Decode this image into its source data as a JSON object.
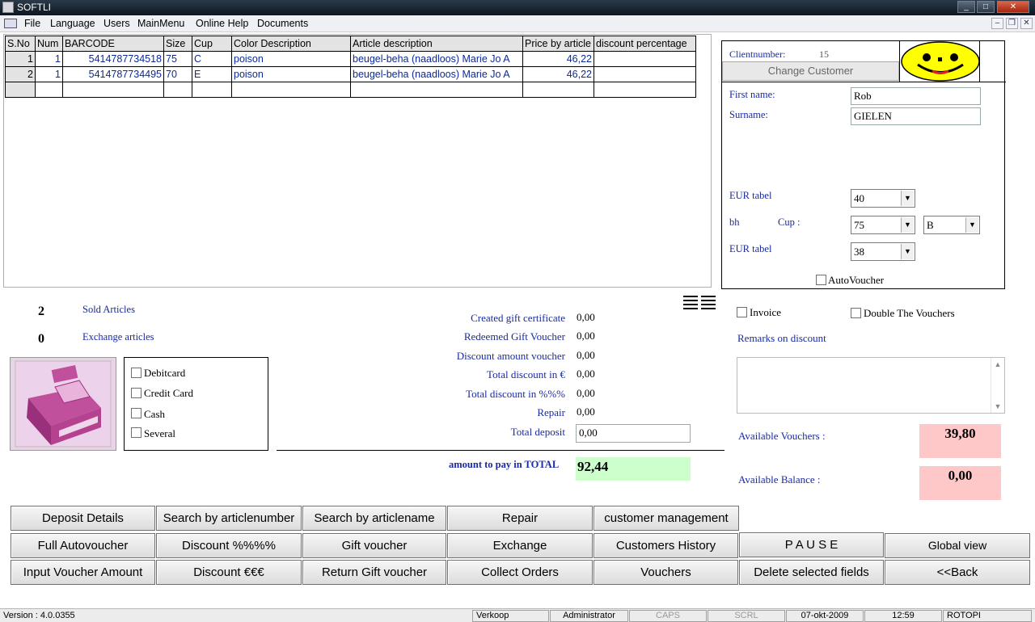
{
  "window": {
    "title": "SOFTLI"
  },
  "menu": [
    "File",
    "Language",
    "Users",
    "MainMenu",
    "Online Help",
    "Documents"
  ],
  "grid": {
    "columns": [
      "S.No",
      "Num",
      "BARCODE",
      "Size",
      "Cup",
      "Color Description",
      "Article description",
      "Price by article",
      "discount percentage"
    ],
    "rows": [
      {
        "sno": "1",
        "num": "1",
        "barcode": "5414787734518",
        "size": "75",
        "cup": "C",
        "color": "poison",
        "article": "beugel-beha (naadloos) Marie Jo A",
        "price": "46,22",
        "discount": ""
      },
      {
        "sno": "2",
        "num": "1",
        "barcode": "5414787734495",
        "size": "70",
        "cup": "E",
        "color": "poison",
        "article": "beugel-beha (naadloos) Marie Jo A",
        "price": "46,22",
        "discount": ""
      }
    ]
  },
  "client": {
    "clientnumber_label": "Clientnumber:",
    "clientnumber": "15",
    "change_customer": "Change Customer",
    "first_name_label": "First name:",
    "first_name": "Rob",
    "surname_label": "Surname:",
    "surname": "GIELEN",
    "eur_tabel_label_1": "EUR tabel",
    "eur_tabel_1": "40",
    "bh_label": "bh",
    "cup_label": "Cup :",
    "bh_size": "75",
    "cup_value": "B",
    "eur_tabel_label_2": "EUR tabel",
    "eur_tabel_2": "38",
    "autovoucher": "AutoVoucher"
  },
  "counts": {
    "sold": "2",
    "sold_label": "Sold Articles",
    "exchange": "0",
    "exchange_label": "Exchange articles"
  },
  "payment_methods": [
    "Debitcard",
    "Credit Card",
    "Cash",
    "Several"
  ],
  "totals": [
    {
      "label": "Created gift certificate",
      "value": "0,00"
    },
    {
      "label": "Redeemed Gift Voucher",
      "value": "0,00"
    },
    {
      "label": "Discount amount voucher",
      "value": "0,00"
    },
    {
      "label": "Total discount in €",
      "value": "0,00"
    },
    {
      "label": "Total discount in %%%",
      "value": "0,00"
    },
    {
      "label": "Repair",
      "value": "0,00"
    }
  ],
  "deposit": {
    "label": "Total deposit",
    "value": "0,00"
  },
  "amount_total": {
    "label": "amount to pay in TOTAL",
    "value": "92,44"
  },
  "options": {
    "invoice": "Invoice",
    "double_vouchers": "Double The Vouchers",
    "remarks_label": "Remarks on discount"
  },
  "available": {
    "vouchers_label": "Available Vouchers :",
    "vouchers": "39,80",
    "balance_label": "Available Balance :",
    "balance": "0,00"
  },
  "buttons": {
    "row1": [
      "Deposit Details",
      "Search by articlenumber",
      "Search by articlename",
      "Repair",
      "customer management"
    ],
    "row2": [
      "Full Autovoucher",
      "Discount %%%%",
      "Gift voucher",
      "Exchange",
      "Customers History",
      "P A U S E",
      "Global view"
    ],
    "row3": [
      "Input Voucher Amount",
      "Discount €€€",
      "Return Gift voucher",
      "Collect Orders",
      "Vouchers",
      "Delete selected fields",
      "<<Back"
    ]
  },
  "status": {
    "version": "Version : 4.0.0355",
    "mode": "Verkoop",
    "user": "Administrator",
    "caps": "CAPS",
    "scrl": "SCRL",
    "date": "07-okt-2009",
    "time": "12:59",
    "host": "ROTOPI"
  },
  "colors": {
    "total_bg": "#ccffcc",
    "available_bg": "#ffc8c8",
    "label_blue": "#1a2aa0"
  },
  "icons": [
    "app-icon",
    "cash-register-icon",
    "smiley-icon",
    "list-view-icon"
  ]
}
